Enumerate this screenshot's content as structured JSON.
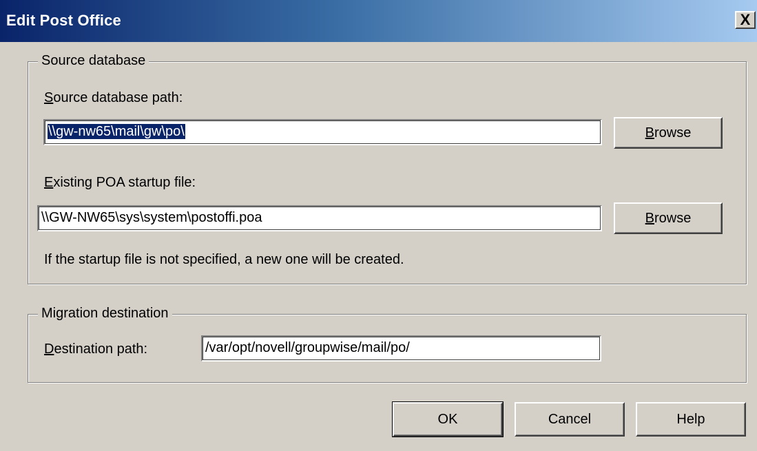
{
  "window": {
    "title": "Edit Post Office",
    "close_glyph": "X"
  },
  "source": {
    "group_label": "Source database",
    "path_label_accel": "S",
    "path_label_rest": "ource database path:",
    "path_value": "\\\\gw-nw65\\mail\\gw\\po\\",
    "browse1_accel": "B",
    "browse1_rest": "rowse",
    "poa_label_accel": "E",
    "poa_label_rest": "xisting POA startup file:",
    "poa_value": "\\\\GW-NW65\\sys\\system\\postoffi.poa",
    "browse2_accel": "B",
    "browse2_rest": "rowse",
    "note": "If the startup file is not specified, a new one will be created."
  },
  "destination": {
    "group_label": "Migration destination",
    "path_label_accel": "D",
    "path_label_rest": "estination path:",
    "path_value": "/var/opt/novell/groupwise/mail/po/"
  },
  "buttons": {
    "ok": "OK",
    "cancel": "Cancel",
    "help": "Help"
  },
  "colors": {
    "titlebar_start": "#0a246a",
    "titlebar_end": "#a6caf0",
    "dialog_bg": "#d4d0c8",
    "selection": "#0a246a"
  }
}
